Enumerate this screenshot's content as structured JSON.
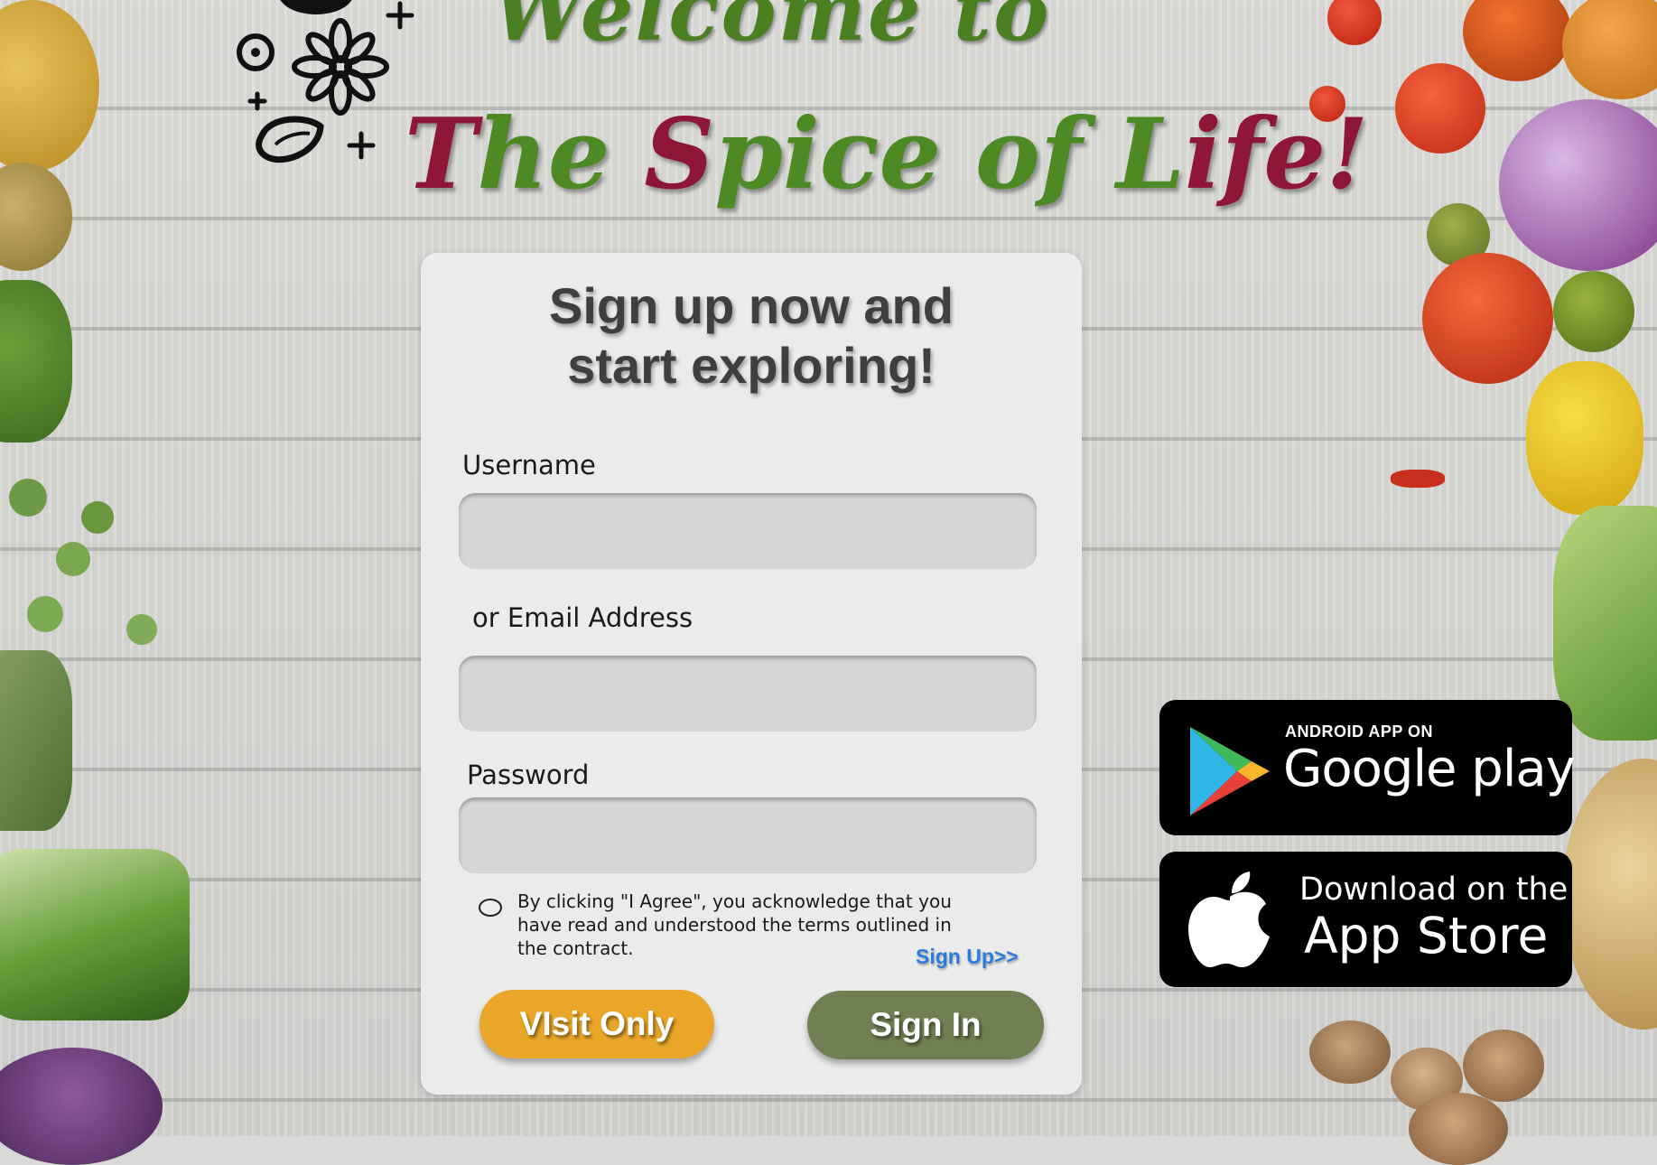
{
  "header": {
    "welcome_text": "Welcome to",
    "title_part1_red": "T",
    "title_part1_green": "he ",
    "title_part2_red": "S",
    "title_part2_green": "pice of ",
    "title_part3_red": "L",
    "title_part3_green": "ife",
    "title_part4_red": "!"
  },
  "card": {
    "heading_line1": "Sign up now and",
    "heading_line2": "start exploring!",
    "username_label": "Username",
    "email_label": "or Email Address",
    "password_label": "Password",
    "username_value": "",
    "email_value": "",
    "password_value": "",
    "agree_text": "By clicking \"I Agree\", you acknowledge that you have read and understood the terms outlined in the contract.",
    "signup_link": "Sign Up>>",
    "visit_button": "VIsit Only",
    "signin_button": "Sign In"
  },
  "badges": {
    "google_small": "ANDROID APP ON",
    "google_big": "Google play",
    "apple_small": "Download on the",
    "apple_big": "App Store"
  },
  "colors": {
    "title_green": "#4e8a24",
    "title_red": "#8e1636",
    "visit_button": "#e9a628",
    "signin_button": "#6f7f52",
    "link_blue": "#2a7bdc"
  },
  "icons": [
    "flower-icon",
    "circle-icon",
    "sparkle-icon",
    "seed-icon",
    "google-play-icon",
    "apple-icon"
  ]
}
